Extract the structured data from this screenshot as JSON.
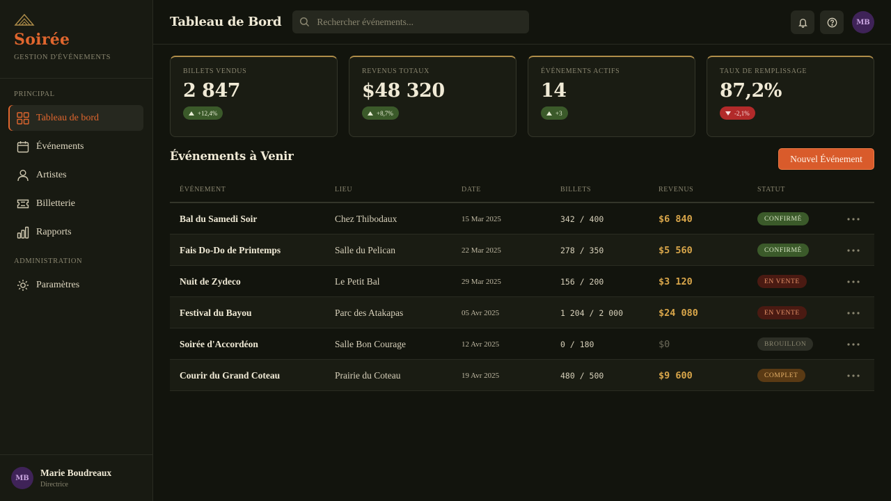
{
  "brand": {
    "name": "Soirée",
    "tagline": "GESTION D'ÉVÉNEMENTS",
    "logo_icon": "pyramid-icon",
    "accent": "#e0662e"
  },
  "sidebar": {
    "section_principal": "PRINCIPAL",
    "section_admin": "ADMINISTRATION",
    "items": [
      {
        "label": "Tableau de bord",
        "icon": "grid-icon",
        "active": true
      },
      {
        "label": "Événements",
        "icon": "calendar-icon"
      },
      {
        "label": "Artistes",
        "icon": "user-icon"
      },
      {
        "label": "Billetterie",
        "icon": "ticket-icon"
      },
      {
        "label": "Rapports",
        "icon": "bar-chart-icon"
      },
      {
        "label": "Paramètres",
        "icon": "gear-icon"
      }
    ],
    "user": {
      "initials": "MB",
      "name": "Marie Boudreaux",
      "role": "Directrice"
    }
  },
  "header": {
    "title": "Tableau de Bord",
    "search_placeholder": "Rechercher événements...",
    "avatar_initials": "MB"
  },
  "stats": [
    {
      "label": "BILLETS VENDUS",
      "value": "2 847",
      "delta": "+12,4%",
      "trend": "up"
    },
    {
      "label": "REVENUS TOTAUX",
      "value": "$48 320",
      "delta": "+8,7%",
      "trend": "up"
    },
    {
      "label": "ÉVÉNEMENTS ACTIFS",
      "value": "14",
      "delta": "+3",
      "trend": "up"
    },
    {
      "label": "TAUX DE REMPLISSAGE",
      "value": "87,2%",
      "delta": "-2,1%",
      "trend": "down"
    }
  ],
  "events": {
    "title": "Événements à Venir",
    "new_button": "Nouvel Événement",
    "columns": [
      "ÉVÉNEMENT",
      "LIEU",
      "DATE",
      "BILLETS",
      "REVENUS",
      "STATUT"
    ],
    "rows": [
      {
        "name": "Bal du Samedi Soir",
        "lieu": "Chez Thibodaux",
        "date": "15 Mar 2025",
        "billets": "342 / 400",
        "revenus": "$6 840",
        "statut": "CONFIRMÉ",
        "status_type": "confirm"
      },
      {
        "name": "Fais Do-Do de Printemps",
        "lieu": "Salle du Pelican",
        "date": "22 Mar 2025",
        "billets": "278 / 350",
        "revenus": "$5 560",
        "statut": "CONFIRMÉ",
        "status_type": "confirm"
      },
      {
        "name": "Nuit de Zydeco",
        "lieu": "Le Petit Bal",
        "date": "29 Mar 2025",
        "billets": "156 / 200",
        "revenus": "$3 120",
        "statut": "EN VENTE",
        "status_type": "vente"
      },
      {
        "name": "Festival du Bayou",
        "lieu": "Parc des Atakapas",
        "date": "05 Avr 2025",
        "billets": "1 204 / 2 000",
        "revenus": "$24 080",
        "statut": "EN VENTE",
        "status_type": "vente"
      },
      {
        "name": "Soirée d'Accordéon",
        "lieu": "Salle Bon Courage",
        "date": "12 Avr 2025",
        "billets": "0 / 180",
        "revenus": "$0",
        "statut": "BROUILLON",
        "status_type": "brouillon"
      },
      {
        "name": "Courir du Grand Coteau",
        "lieu": "Prairie du Coteau",
        "date": "19 Avr 2025",
        "billets": "480 / 500",
        "revenus": "$9 600",
        "statut": "COMPLET",
        "status_type": "complet"
      }
    ]
  }
}
